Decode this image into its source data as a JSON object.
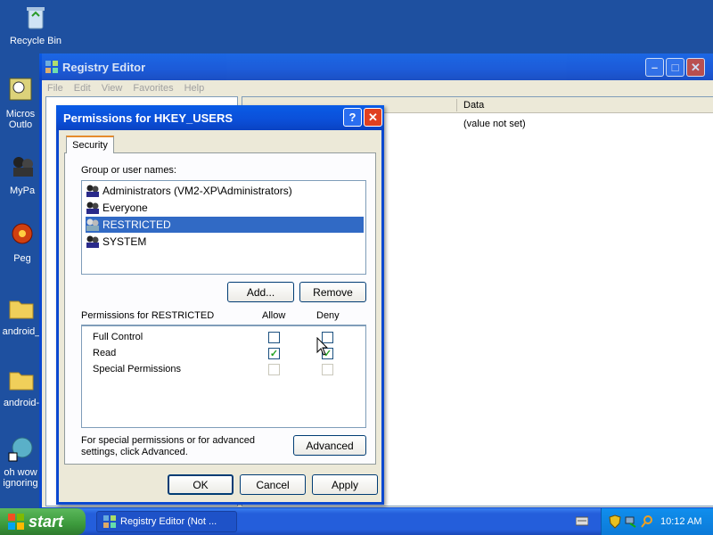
{
  "desktop": {
    "icons": [
      {
        "label": "Recycle Bin"
      },
      {
        "label": "Micros\nOutlo"
      },
      {
        "label": "MyPa"
      },
      {
        "label": "Peg"
      },
      {
        "label": "android_"
      },
      {
        "label": "android-"
      },
      {
        "label": "oh wow\nignoring"
      }
    ]
  },
  "regedit": {
    "title": "Registry Editor",
    "menu": [
      "File",
      "Edit",
      "View",
      "Favorites",
      "Help"
    ],
    "col_data": "Data",
    "value_data": "(value not set)"
  },
  "dialog": {
    "title": "Permissions for HKEY_USERS",
    "tab": "Security",
    "group_label": "Group or user names:",
    "users": [
      "Administrators (VM2-XP\\Administrators)",
      "Everyone",
      "RESTRICTED",
      "SYSTEM"
    ],
    "selected_index": 2,
    "add_label": "Add...",
    "remove_label": "Remove",
    "perm_label": "Permissions for RESTRICTED",
    "allow_label": "Allow",
    "deny_label": "Deny",
    "permissions": [
      {
        "name": "Full Control",
        "allow": false,
        "deny": false,
        "disabled": false
      },
      {
        "name": "Read",
        "allow": true,
        "deny": true,
        "disabled": false
      },
      {
        "name": "Special Permissions",
        "allow": false,
        "deny": false,
        "disabled": true
      }
    ],
    "advanced_text": "For special permissions or for advanced settings, click Advanced.",
    "advanced_label": "Advanced",
    "ok_label": "OK",
    "cancel_label": "Cancel",
    "apply_label": "Apply"
  },
  "taskbar": {
    "start_label": "start",
    "task_label": "Registry Editor (Not ...",
    "clock": "10:12 AM"
  },
  "colors": {
    "selection": "#316ac5",
    "taskbar": "#245edb",
    "start": "#3c9a3c"
  }
}
